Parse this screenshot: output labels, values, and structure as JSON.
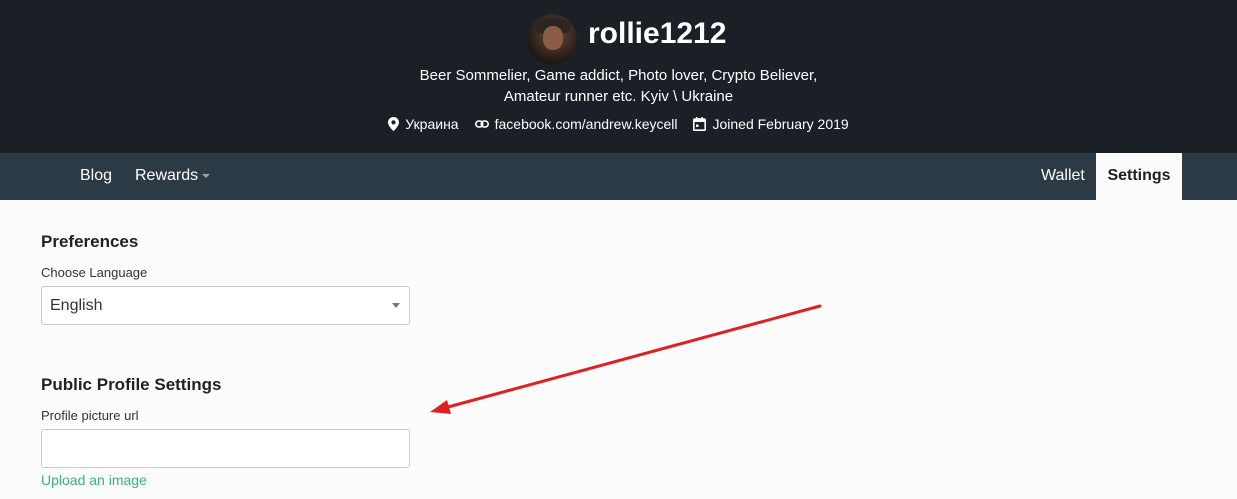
{
  "profile": {
    "username": "rollie1212",
    "about_line1": "Beer Sommelier, Game addict, Photo lover, Crypto Believer,",
    "about_line2": "Amateur runner etc. Kyiv \\ Ukraine",
    "location": "Украина",
    "website": "facebook.com/andrew.keycell",
    "joined": "Joined February 2019",
    "icons": {
      "location": "location-pin-icon",
      "website": "link-icon",
      "joined": "calendar-icon"
    }
  },
  "nav": {
    "blog": "Blog",
    "rewards": "Rewards",
    "wallet": "Wallet",
    "settings": "Settings"
  },
  "preferences": {
    "title": "Preferences",
    "language_label": "Choose Language",
    "language_value": "English"
  },
  "public_profile": {
    "title": "Public Profile Settings",
    "picture_label": "Profile picture url",
    "picture_value": "",
    "upload_link": "Upload an image"
  },
  "colors": {
    "hero_bg": "#1b2026",
    "nav_bg": "#2c3a46",
    "link": "#3ab07f",
    "annotation_arrow": "#e02020"
  }
}
